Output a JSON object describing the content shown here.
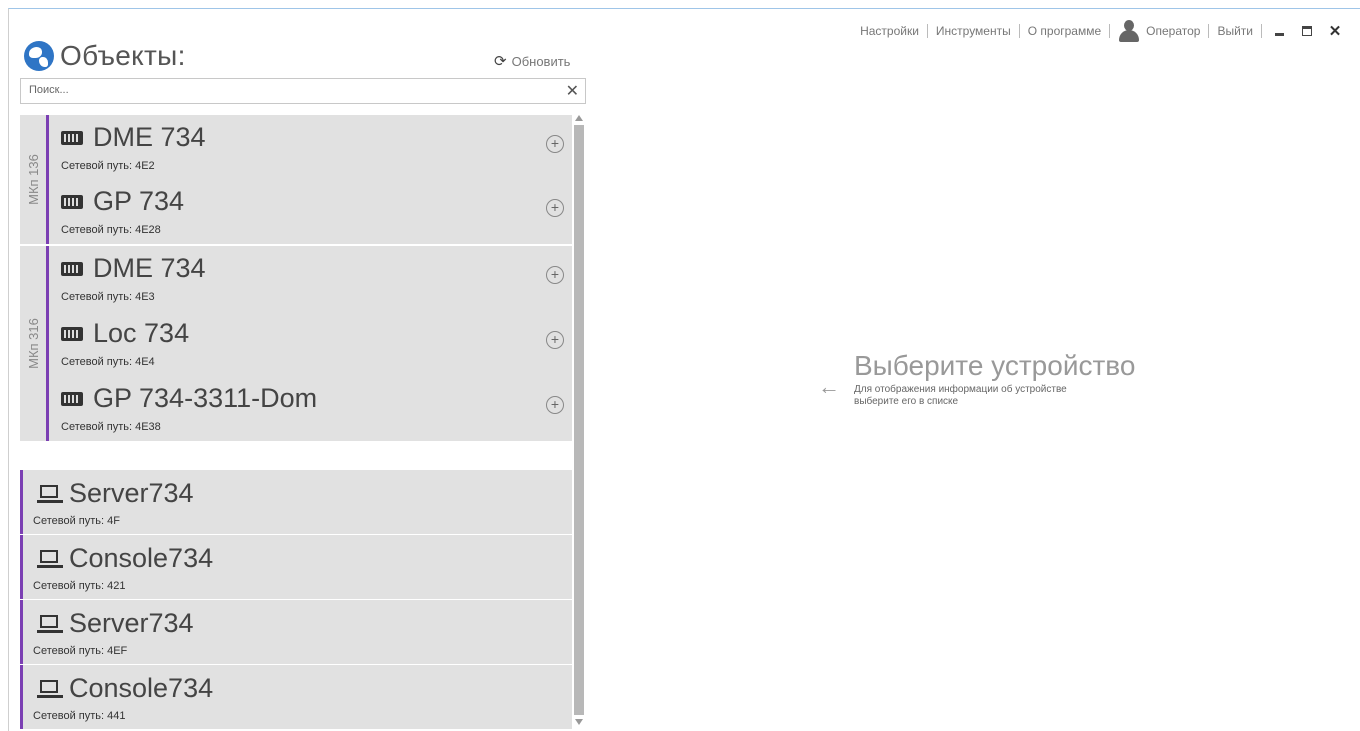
{
  "topbar": {
    "links": [
      "Настройки",
      "Инструменты",
      "О программе"
    ],
    "user_label": "Оператор",
    "logout": "Выйти"
  },
  "panel": {
    "title": "Объекты:",
    "refresh": "Обновить",
    "search_placeholder": "Поиск...",
    "groups": [
      {
        "label": "МКп 136",
        "items": [
          {
            "name": "DME 734",
            "path": "Сетевой путь: 4E2"
          },
          {
            "name": "GP 734",
            "path": "Сетевой путь: 4E28"
          }
        ]
      },
      {
        "label": "МКп 316",
        "items": [
          {
            "name": "DME 734",
            "path": "Сетевой путь: 4E3"
          },
          {
            "name": "Loc 734",
            "path": "Сетевой путь: 4E4"
          },
          {
            "name": "GP 734-3311-Dom",
            "path": "Сетевой путь: 4E38"
          }
        ]
      }
    ],
    "computers": [
      {
        "name": "Server734",
        "path": "Сетевой путь: 4F"
      },
      {
        "name": "Console734",
        "path": "Сетевой путь: 421"
      },
      {
        "name": "Server734",
        "path": "Сетевой путь: 4EF"
      },
      {
        "name": "Console734",
        "path": "Сетевой путь: 441"
      }
    ]
  },
  "placeholder": {
    "title": "Выберите устройство",
    "line1": "Для отображения информации об устройстве",
    "line2": "выберите его в списке"
  },
  "colors": {
    "accent": "#7b3fb3",
    "list_bg": "#e1e1e1",
    "globe": "#2f75c5"
  },
  "icons": [
    "globe-icon",
    "refresh-icon",
    "device-icon",
    "laptop-icon",
    "add-icon",
    "arrow-left-icon",
    "user-icon"
  ]
}
